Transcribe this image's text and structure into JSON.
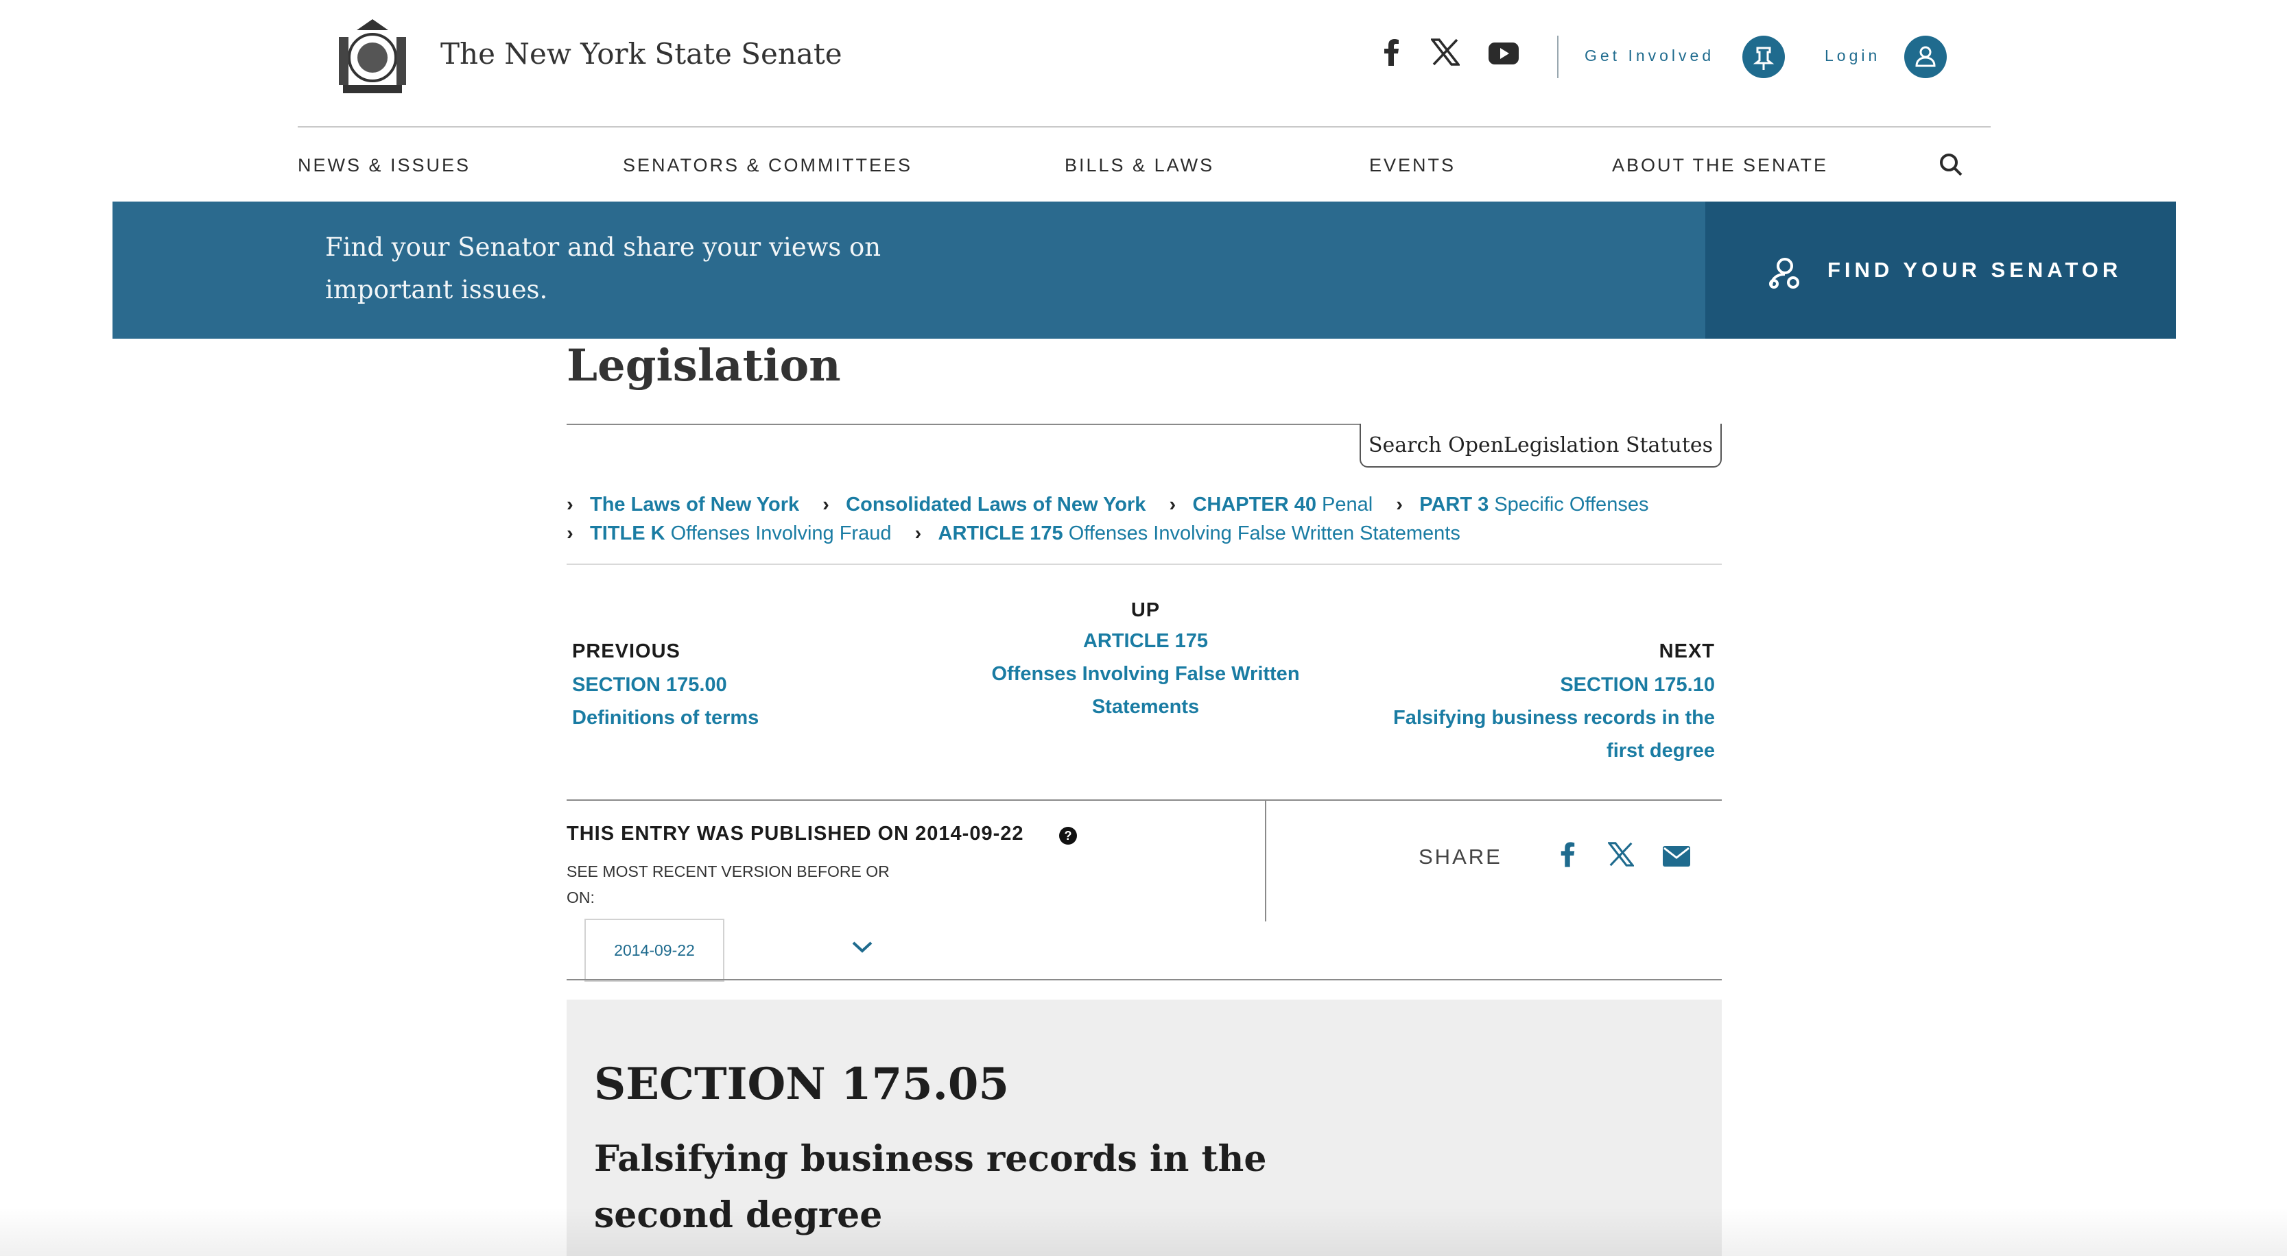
{
  "header": {
    "site_title": "The New York State Senate",
    "get_involved": "Get Involved",
    "login": "Login"
  },
  "nav": {
    "items": [
      "NEWS & ISSUES",
      "SENATORS & COMMITTEES",
      "BILLS & LAWS",
      "EVENTS",
      "ABOUT THE SENATE"
    ]
  },
  "banner": {
    "text": "Find your Senator and share your views on important issues.",
    "cta": "FIND YOUR SENATOR"
  },
  "page": {
    "title": "Legislation",
    "search_tab": "Search OpenLegislation Statutes"
  },
  "breadcrumbs": [
    {
      "strong": "The Laws of New York",
      "rest": ""
    },
    {
      "strong": "Consolidated Laws of New York",
      "rest": ""
    },
    {
      "strong": "CHAPTER 40",
      "rest": "Penal"
    },
    {
      "strong": "PART 3",
      "rest": "Specific Offenses"
    },
    {
      "strong": "TITLE K",
      "rest": "Offenses Involving Fraud"
    },
    {
      "strong": "ARTICLE 175",
      "rest": "Offenses Involving False Written Statements"
    }
  ],
  "pager": {
    "previous_label": "PREVIOUS",
    "previous_link1": "SECTION 175.00",
    "previous_link2": "Definitions of terms",
    "up_label": "UP",
    "up_link1": "ARTICLE 175",
    "up_link2": "Offenses Involving False Written",
    "up_link3": "Statements",
    "next_label": "NEXT",
    "next_link1": "SECTION 175.10",
    "next_link2": "Falsifying business records in the",
    "next_link3": "first degree"
  },
  "publication": {
    "published": "THIS ENTRY WAS PUBLISHED ON 2014-09-22",
    "help": "?",
    "see_recent": "SEE MOST RECENT VERSION BEFORE OR ON:",
    "date_value": "2014-09-22",
    "share": "SHARE"
  },
  "section": {
    "number": "SECTION 175.05",
    "title": "Falsifying business records in the second degree"
  },
  "colors": {
    "brand_blue": "#1f6b8e",
    "link_blue": "#1a7ca3",
    "banner": "#2b6a8e",
    "banner_dark": "#1c5578"
  }
}
